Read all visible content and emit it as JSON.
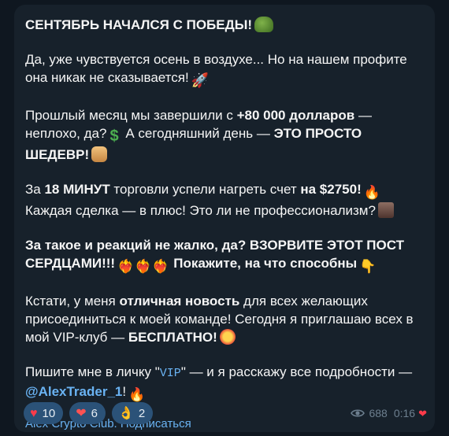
{
  "post": {
    "title": "СЕНТЯБРЬ НАЧАЛСЯ С ПОБЕДЫ!",
    "p1": "Да, уже чувствуется осень в воздухе... Но на нашем профите она никак не сказывается!",
    "p2_a": "Прошлый месяц мы завершили с ",
    "p2_bold": "+80 000 долларов",
    "p2_b": " — неплохо, да?",
    "p2_c": " А сегодняшний день — ",
    "p2_bold2": "ЭТО ПРОСТО ШЕДЕВР!",
    "p3_a": "За ",
    "p3_bold": "18 МИНУТ",
    "p3_b": " торговли успели нагреть счет ",
    "p3_bold2": "на $2750!",
    "p3_c": " Каждая сделка — в плюс! Это ли не профессионализм?",
    "p4_bold": "За такое и реакций не жалко, да? ВЗОРВИТЕ ЭТОТ ПОСТ СЕРДЦАМИ!!!",
    "p4_bold2": " Покажите, на что способны",
    "p5_a": "Кстати, у меня ",
    "p5_bold": "отличная новость",
    "p5_b": " для всех желающих присоединиться к моей команде! Сегодня я приглашаю всех в мой VIP-клуб — ",
    "p5_bold2": "БЕСПЛАТНО!",
    "p6_a": "Пишите мне в личку \"",
    "p6_code": "VIP",
    "p6_b": "\" — и я расскажу все подробности —",
    "p6_mention": "@AlexTrader_1",
    "p6_c": "!",
    "channel_link": "Alex Crypto Club. Подписаться"
  },
  "reactions": [
    {
      "icon": "heart-icon",
      "glyph": "♥",
      "count": "10"
    },
    {
      "icon": "heart-on-fire-icon",
      "glyph": "❤",
      "count": "6"
    },
    {
      "icon": "ok-hand-icon",
      "glyph": "👌",
      "count": "2"
    }
  ],
  "meta": {
    "views": "688",
    "time": "0:16"
  },
  "colors": {
    "bubble": "#17212b",
    "background": "#0e1621",
    "link": "#6ab3f3",
    "reaction_bg": "#2b5278",
    "muted": "#6d7f8f"
  }
}
